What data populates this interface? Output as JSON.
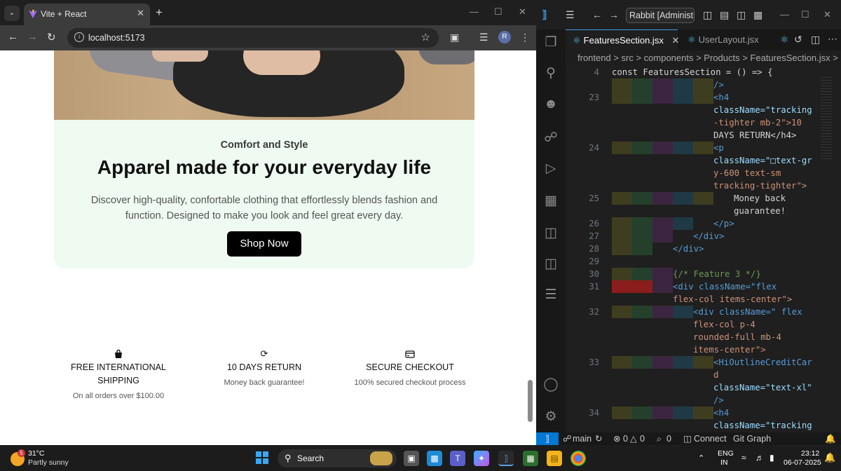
{
  "browser": {
    "tab_title": "Vite + React",
    "url": "localhost:5173",
    "profile_initial": "R"
  },
  "hero": {
    "eyebrow": "Comfort and Style",
    "title": "Apparel made for your everyday life",
    "description": "Discover high-quality, confortable clothing that effortlessly blends fashion and function. Designed to make you look and feel great every day.",
    "button": "Shop Now"
  },
  "features": [
    {
      "icon": "shopping-bag-icon",
      "title": "FREE INTERNATIONAL SHIPPING",
      "subtitle": "On all orders over $100.00"
    },
    {
      "icon": "refresh-icon",
      "title": "10 DAYS RETURN",
      "subtitle": "Money back guarantee!"
    },
    {
      "icon": "credit-card-icon",
      "title": "SECURE CHECKOUT",
      "subtitle": "100% secured checkout process"
    }
  ],
  "vscode": {
    "command_center": "Rabbit [Administra",
    "tabs": [
      "FeaturesSection.jsx",
      "UserLayout.jsx"
    ],
    "breadcrumb": "frontend > src > components > Products > FeaturesSection.jsx > ...",
    "sticky_line_number": "4",
    "sticky_line": "const FeaturesSection = () => {",
    "status": {
      "branch": "main",
      "errors": "0",
      "warnings": "0",
      "ports": "0",
      "connect": "Connect",
      "git_graph": "Git Graph"
    }
  },
  "code_lines": [
    {
      "n": "",
      "text": "/>"
    },
    {
      "n": "23",
      "text": "<h4"
    },
    {
      "n": "",
      "text": "className=\"tracking"
    },
    {
      "n": "",
      "text": "-tighter mb-2\">10"
    },
    {
      "n": "",
      "text": "DAYS RETURN</h4>"
    },
    {
      "n": "24",
      "text": "<p"
    },
    {
      "n": "",
      "text": "className=\"□text-gr"
    },
    {
      "n": "",
      "text": "y-600 text-sm"
    },
    {
      "n": "",
      "text": "tracking-tighter\">"
    },
    {
      "n": "25",
      "text": "Money back"
    },
    {
      "n": "",
      "text": "guarantee!"
    },
    {
      "n": "26",
      "text": "</p>"
    },
    {
      "n": "27",
      "text": "</div>"
    },
    {
      "n": "28",
      "text": "</div>"
    },
    {
      "n": "29",
      "text": ""
    },
    {
      "n": "30",
      "text": "{/* Feature 3 */}"
    },
    {
      "n": "31",
      "text": "<div className=\"flex"
    },
    {
      "n": "",
      "text": "flex-col items-center\">"
    },
    {
      "n": "32",
      "text": "<div className=\" flex"
    },
    {
      "n": "",
      "text": "flex-col p-4"
    },
    {
      "n": "",
      "text": "rounded-full mb-4"
    },
    {
      "n": "",
      "text": "items-center\">"
    },
    {
      "n": "33",
      "text": "<HiOutlineCreditCar"
    },
    {
      "n": "",
      "text": "d"
    },
    {
      "n": "",
      "text": "className=\"text-xl\""
    },
    {
      "n": "",
      "text": "/>"
    },
    {
      "n": "34",
      "text": "<h4"
    },
    {
      "n": "",
      "text": "className=\"tracking"
    }
  ],
  "taskbar": {
    "temperature": "31°C",
    "weather": "Partly sunny",
    "weather_badge": "5",
    "search_placeholder": "Search",
    "lang": "ENG",
    "region": "IN",
    "time": "23:12",
    "date": "06-07-2025"
  },
  "colors": {
    "hero_panel": "#effbf1",
    "button": "#000000",
    "vscode_accent": "#0078d4"
  }
}
